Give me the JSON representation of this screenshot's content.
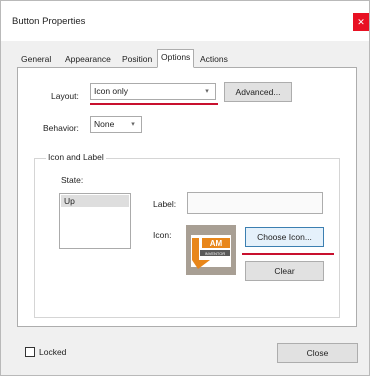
{
  "window": {
    "title": "Button Properties"
  },
  "tabs": [
    {
      "label": "General"
    },
    {
      "label": "Appearance"
    },
    {
      "label": "Position"
    },
    {
      "label": "Options"
    },
    {
      "label": "Actions"
    }
  ],
  "options": {
    "layout_label": "Layout:",
    "layout_value": "Icon only",
    "advanced_label": "Advanced...",
    "behavior_label": "Behavior:",
    "behavior_value": "None",
    "group_title": "Icon and Label",
    "state_label": "State:",
    "states": [
      "Up"
    ],
    "label_label": "Label:",
    "label_value": "",
    "icon_label": "Icon:",
    "icon_text_top": "I AM",
    "icon_text_bottom": "INVENTOR",
    "choose_icon_label": "Choose Icon...",
    "clear_label": "Clear"
  },
  "footer": {
    "locked_label": "Locked",
    "close_label": "Close"
  },
  "colors": {
    "annotation_red": "#c8102e",
    "close_red": "#e81123",
    "icon_orange": "#e8861a"
  }
}
